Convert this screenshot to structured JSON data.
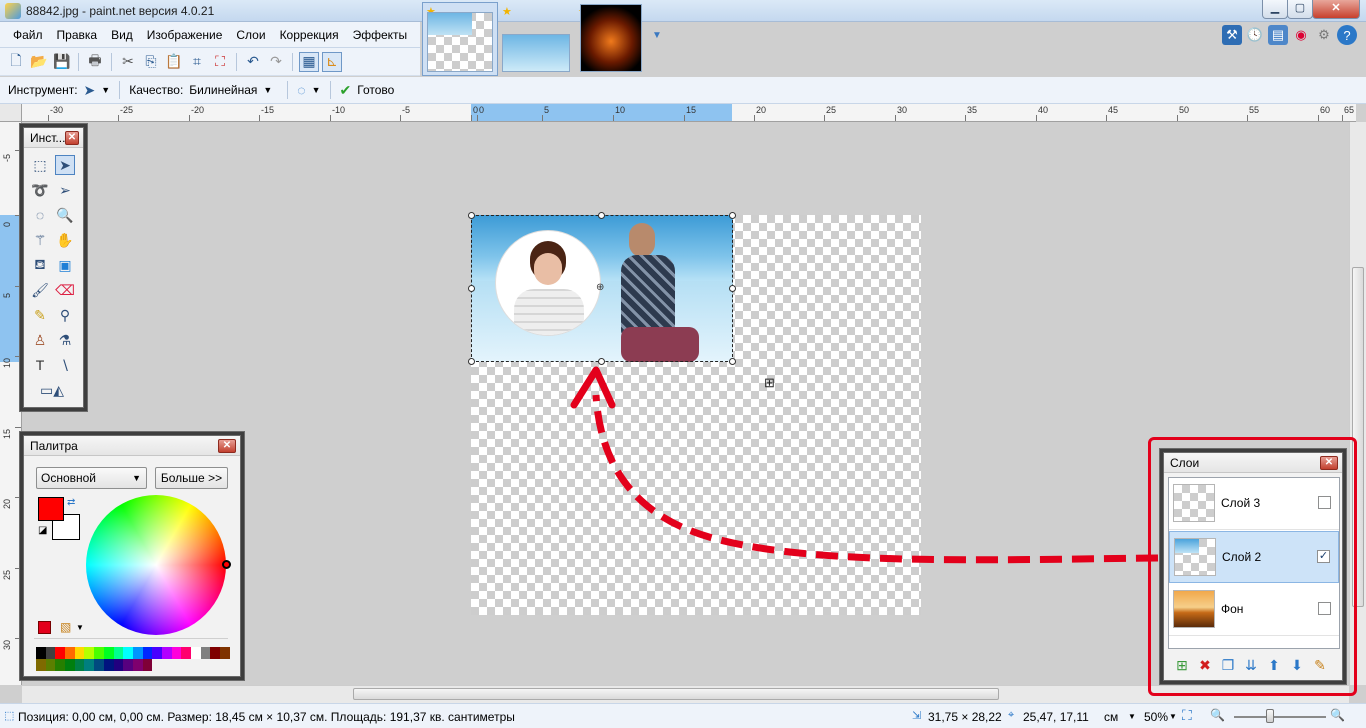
{
  "window": {
    "title": "88842.jpg - paint.net версия 4.0.21",
    "min_label": "▁",
    "max_label": "▢",
    "close_label": "✕"
  },
  "menu": {
    "items": [
      "Файл",
      "Правка",
      "Вид",
      "Изображение",
      "Слои",
      "Коррекция",
      "Эффекты"
    ]
  },
  "toolbar": {
    "icons": [
      "new-icon",
      "open-icon",
      "save-icon",
      "print-icon",
      "cut-icon",
      "copy-icon",
      "paste-icon",
      "crop-icon",
      "deselect-icon",
      "undo-icon",
      "redo-icon",
      "grid-icon",
      "rulers-icon"
    ]
  },
  "options": {
    "tool_label": "Инструмент:",
    "quality_label": "Качество:",
    "quality_value": "Билинейная",
    "done_label": "Готово"
  },
  "ruler": {
    "top_labels": [
      "-30",
      "-25",
      "-20",
      "-15",
      "-10",
      "-5",
      "0",
      "0",
      "5",
      "10",
      "15",
      "20",
      "25",
      "30",
      "35",
      "40",
      "45",
      "50",
      "55",
      "60",
      "65"
    ],
    "left_labels": [
      "-5",
      "0",
      "5",
      "10",
      "15",
      "20",
      "25",
      "30"
    ]
  },
  "tools_panel": {
    "title": "Инст...",
    "tools": [
      "rectangle-select-icon",
      "move-selected-pixels-icon",
      "lasso-select-icon",
      "move-selection-icon",
      "ellipse-select-icon",
      "zoom-icon",
      "magic-wand-icon",
      "pan-icon",
      "paint-bucket-icon",
      "gradient-icon",
      "paintbrush-icon",
      "eraser-icon",
      "pencil-icon",
      "color-picker-icon",
      "clone-stamp-icon",
      "recolor-icon",
      "text-icon",
      "line-curve-icon",
      "shapes-icon"
    ]
  },
  "palette_panel": {
    "title": "Палитра",
    "mode_value": "Основной",
    "more_button": "Больше >>",
    "primary_color": "#ff0000",
    "secondary_color": "#ffffff",
    "swatches": [
      "#000000",
      "#404040",
      "#ff0000",
      "#ff6a00",
      "#ffd800",
      "#b6ff00",
      "#4cff00",
      "#00ff21",
      "#00ff90",
      "#00ffff",
      "#0094ff",
      "#0026ff",
      "#4800ff",
      "#b200ff",
      "#ff00dc",
      "#ff006e",
      "#ffffff",
      "#808080",
      "#7f0000",
      "#7f3300",
      "#7f6a00",
      "#5b7f00",
      "#267f00",
      "#007f0e",
      "#007f46",
      "#007f7f",
      "#004a7f",
      "#00137f",
      "#21007f",
      "#57007f",
      "#7f006e",
      "#7f0037"
    ]
  },
  "layers_panel": {
    "title": "Слои",
    "layers": [
      {
        "name": "Слой 3",
        "visible": false,
        "selected": false
      },
      {
        "name": "Слой 2",
        "visible": true,
        "selected": true
      },
      {
        "name": "Фон",
        "visible": false,
        "selected": false
      }
    ],
    "actions": [
      "add-layer-icon",
      "delete-layer-icon",
      "duplicate-layer-icon",
      "merge-down-icon",
      "move-up-icon",
      "move-down-icon",
      "layer-properties-icon"
    ]
  },
  "status": {
    "left": "Позиция: 0,00 см, 0,00 см. Размер: 18,45 см × 10,37 см. Площадь: 191,37 кв. сантиметры",
    "size": "31,75 × 28,22",
    "cursor": "25,47, 17,11",
    "units": "см",
    "zoom": "50%"
  },
  "colors": {
    "accent": "#e3001b",
    "selection": "#cfe3f7",
    "brand": "#2b78c8"
  }
}
